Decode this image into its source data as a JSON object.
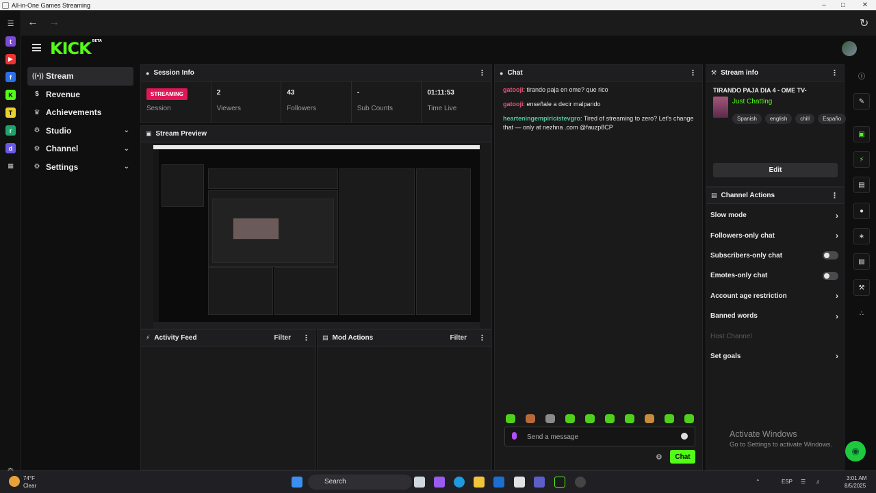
{
  "window": {
    "title": "All-in-One Games Streaming"
  },
  "sidenav": {
    "items": [
      {
        "label": "Stream",
        "icon": "broadcast-icon"
      },
      {
        "label": "Revenue",
        "icon": "dollar-icon"
      },
      {
        "label": "Achievements",
        "icon": "trophy-icon"
      },
      {
        "label": "Studio",
        "icon": "studio-gear-icon"
      },
      {
        "label": "Channel",
        "icon": "channel-gear-icon"
      },
      {
        "label": "Settings",
        "icon": "settings-gear-icon"
      }
    ]
  },
  "logo": {
    "text": "KICK",
    "tag": "BETA"
  },
  "session": {
    "title": "Session Info",
    "badge": "STREAMING",
    "label": "Session",
    "stats": [
      {
        "value": "2",
        "label": "Viewers"
      },
      {
        "value": "43",
        "label": "Followers"
      },
      {
        "value": "-",
        "label": "Sub Counts"
      },
      {
        "value": "01:11:53",
        "label": "Time Live"
      }
    ]
  },
  "preview": {
    "title": "Stream Preview"
  },
  "activity": {
    "title": "Activity Feed",
    "filter": "Filter"
  },
  "mod": {
    "title": "Mod Actions",
    "filter": "Filter"
  },
  "chat": {
    "title": "Chat",
    "messages": [
      {
        "user": "gatooji",
        "text": ": tirando paja en ome? que rico",
        "color": "#e8557a"
      },
      {
        "user": "gatooji",
        "text": ": enseñale a decir malparido",
        "color": "#e8557a"
      },
      {
        "user": "hearteningempiricistevgro",
        "text": ": Tired of streaming to zero? Let's change that — only at nezhna .com @fauzp8CP",
        "color": "#53c9a0"
      }
    ],
    "placeholder": "Send a message",
    "send": "Chat"
  },
  "stream_info": {
    "title": "Stream info",
    "stream_title": "TIRANDO PAJA DIA 4 - OME TV-",
    "category": "Just Chatting",
    "tags": [
      "Spanish",
      "english",
      "chill",
      "Españo"
    ],
    "edit": "Edit"
  },
  "channel_actions": {
    "title": "Channel Actions",
    "items": [
      {
        "label": "Slow mode",
        "kind": "arrow"
      },
      {
        "label": "Followers-only chat",
        "kind": "arrow"
      },
      {
        "label": "Subscribers-only chat",
        "kind": "toggle"
      },
      {
        "label": "Emotes-only chat",
        "kind": "toggle"
      },
      {
        "label": "Account age restriction",
        "kind": "arrow"
      },
      {
        "label": "Banned words",
        "kind": "arrow"
      },
      {
        "label": "Host Channel",
        "kind": "disabled"
      },
      {
        "label": "Set goals",
        "kind": "arrow"
      }
    ]
  },
  "watermark": {
    "line1": "Activate Windows",
    "line2": "Go to Settings to activate Windows."
  },
  "taskbar": {
    "weather_temp": "74°F",
    "weather_desc": "Clear",
    "search": "Search",
    "lang": "ESP",
    "time": "3:01 AM",
    "date": "8/5/2025"
  },
  "colors": {
    "accent": "#53fc18",
    "live": "#e01657"
  }
}
